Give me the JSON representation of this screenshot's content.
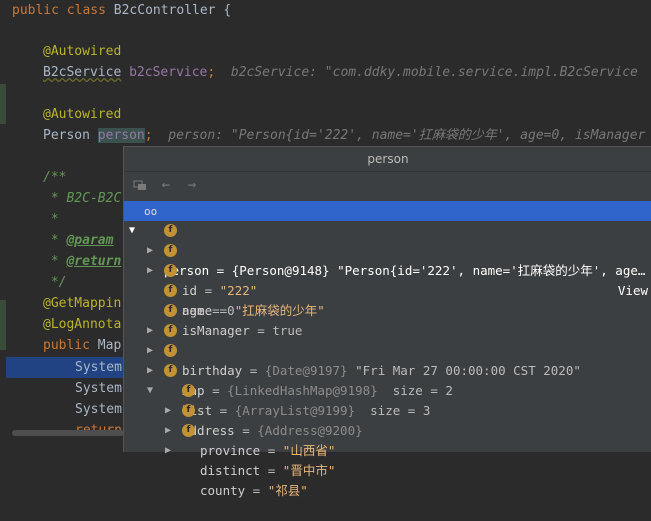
{
  "editor": {
    "line1": {
      "kw1": "public",
      "kw2": "class",
      "name": "B2cController",
      "brace": "{"
    },
    "autowired1": "@Autowired",
    "svc_line": {
      "type": "B2cService",
      "var": "b2cService",
      "semi": ";",
      "hint": "b2cService: \"com.ddky.mobile.service.impl.B2cService"
    },
    "autowired2": "@Autowired",
    "person_line": {
      "type": "Person",
      "var": "person",
      "semi": ";",
      "hint": "person: \"Person{id='222', name='扛麻袋的少年', age=0, isManager"
    },
    "doc_open": "/**",
    "doc_b2c": " * B2C-B2C",
    "doc_star": " *",
    "doc_param_star": " * ",
    "doc_param": "@param",
    "doc_return_star": " * ",
    "doc_return": "@return",
    "doc_close": " */",
    "get_mapping": "@GetMappin",
    "log_anno": "@LogAnnota",
    "public_kw": "public",
    "public_rest": " Map",
    "sys1": "System",
    "sys2": "System",
    "sys3": "System",
    "return_kw": "return"
  },
  "popup": {
    "title": "person",
    "rows": {
      "person": {
        "name": "person",
        "eq": " = ",
        "type": "{Person@9148}",
        "value": " \"Person{id='222', name='扛麻袋的少年', age…",
        "view": "View"
      },
      "id": {
        "name": "id",
        "eq": " = ",
        "value": "\"222\""
      },
      "name": {
        "name": "name",
        "eq": " = ",
        "value": "\"扛麻袋的少年\""
      },
      "age": {
        "name": "age",
        "eq": " = ",
        "value": "0"
      },
      "isManager": {
        "name": "isManager",
        "eq": " = ",
        "value": "true"
      },
      "birthday": {
        "name": "birthday",
        "eq": " = ",
        "type": "{Date@9197}",
        "value": " \"Fri Mar 27 00:00:00 CST 2020\""
      },
      "map": {
        "name": "map",
        "eq": " = ",
        "type": "{LinkedHashMap@9198}",
        "value": "  size = 2"
      },
      "list": {
        "name": "list",
        "eq": " = ",
        "type": "{ArrayList@9199}",
        "value": "  size = 3"
      },
      "address": {
        "name": "address",
        "eq": " = ",
        "type": "{Address@9200}"
      },
      "province": {
        "name": "province",
        "eq": " = ",
        "value": "\"山西省\""
      },
      "distinct": {
        "name": "distinct",
        "eq": " = ",
        "value": "\"晋中市\""
      },
      "county": {
        "name": "county",
        "eq": " = ",
        "value": "\"祁县\""
      }
    },
    "field_badge": "f"
  },
  "colors": {
    "selection": "#2f65ca",
    "field_badge": "#c39233",
    "background": "#2b2b2b"
  }
}
